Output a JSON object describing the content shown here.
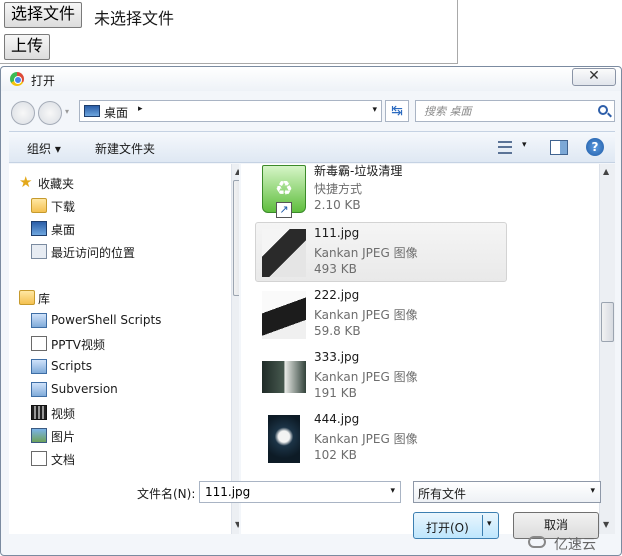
{
  "webpage": {
    "choose_file_label": "选择文件",
    "no_file_label": "未选择文件",
    "upload_label": "上传"
  },
  "dialog": {
    "title": "打开",
    "close_label": "✕",
    "address": {
      "current": "桌面",
      "chevron": "▸",
      "dropdown": "▾"
    },
    "refresh_label": "↹",
    "search": {
      "placeholder": "搜索 桌面"
    },
    "toolbar": {
      "organize_label": "组织 ▾",
      "new_folder_label": "新建文件夹",
      "view_arrow": "▾",
      "help_label": "?"
    },
    "nav": {
      "favorites": {
        "label": "收藏夹",
        "items": [
          {
            "label": "下载",
            "icon": "folder-icon"
          },
          {
            "label": "桌面",
            "icon": "desktop-icon"
          },
          {
            "label": "最近访问的位置",
            "icon": "recent-places-icon"
          }
        ]
      },
      "libraries": {
        "label": "库",
        "items": [
          {
            "label": "PowerShell Scripts",
            "icon": "script-folder-icon"
          },
          {
            "label": "PPTV视频",
            "icon": "document-icon"
          },
          {
            "label": "Scripts",
            "icon": "script-folder-icon"
          },
          {
            "label": "Subversion",
            "icon": "script-folder-icon"
          },
          {
            "label": "视频",
            "icon": "video-library-icon"
          },
          {
            "label": "图片",
            "icon": "pictures-library-icon"
          },
          {
            "label": "文档",
            "icon": "documents-library-icon"
          }
        ]
      }
    },
    "files": [
      {
        "name": "新毒霸-垃圾清理",
        "type": "快捷方式",
        "size": "2.10 KB",
        "selected": false
      },
      {
        "name": "111.jpg",
        "type": "Kankan JPEG 图像",
        "size": "493 KB",
        "selected": true
      },
      {
        "name": "222.jpg",
        "type": "Kankan JPEG 图像",
        "size": "59.8 KB",
        "selected": false
      },
      {
        "name": "333.jpg",
        "type": "Kankan JPEG 图像",
        "size": "191 KB",
        "selected": false
      },
      {
        "name": "444.jpg",
        "type": "Kankan JPEG 图像",
        "size": "102 KB",
        "selected": false
      }
    ],
    "filename_label": "文件名(N):",
    "filename_value": "111.jpg",
    "filetype_value": "所有文件",
    "open_label": "打开(O)",
    "cancel_label": "取消",
    "dropdown_arrow": "▾",
    "scroll_up": "▲",
    "scroll_down": "▼"
  },
  "watermark": "亿速云",
  "colors": {
    "accent": "#3c7fb1",
    "selection": "#e9e9e9",
    "toolbar": "#dfe8f3"
  }
}
